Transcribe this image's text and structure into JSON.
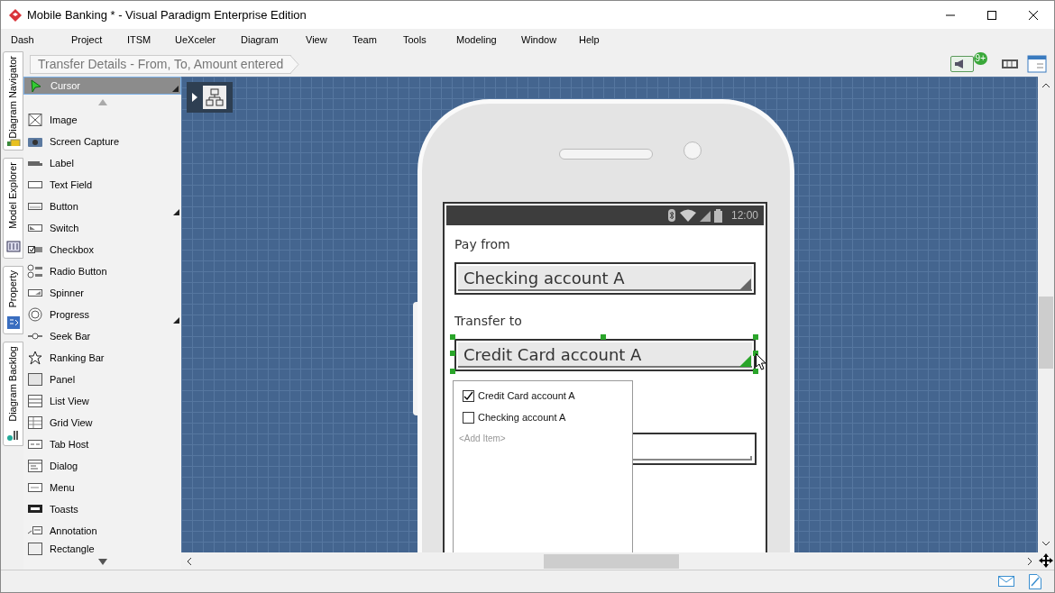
{
  "window": {
    "title": "Mobile Banking * - Visual Paradigm Enterprise Edition"
  },
  "menu": [
    "Dash",
    "Project",
    "ITSM",
    "UeXceler",
    "Diagram",
    "View",
    "Team",
    "Tools",
    "Modeling",
    "Window",
    "Help"
  ],
  "breadcrumb": "Transfer Details - From, To, Amount entered",
  "notifications_badge": "9+",
  "diagram_navigator": {
    "expanded": false
  },
  "side_tabs": [
    "Diagram Navigator",
    "Model Explorer",
    "Property",
    "Diagram Backlog"
  ],
  "palette": [
    {
      "label": "Cursor",
      "selected": true,
      "submenu": true
    },
    {
      "label": "Image",
      "selected": false,
      "submenu": false
    },
    {
      "label": "Screen Capture",
      "selected": false,
      "submenu": false
    },
    {
      "label": "Label",
      "selected": false,
      "submenu": false
    },
    {
      "label": "Text Field",
      "selected": false,
      "submenu": false
    },
    {
      "label": "Button",
      "selected": false,
      "submenu": true
    },
    {
      "label": "Switch",
      "selected": false,
      "submenu": false
    },
    {
      "label": "Checkbox",
      "selected": false,
      "submenu": false
    },
    {
      "label": "Radio Button",
      "selected": false,
      "submenu": false
    },
    {
      "label": "Spinner",
      "selected": false,
      "submenu": false
    },
    {
      "label": "Progress",
      "selected": false,
      "submenu": true
    },
    {
      "label": "Seek Bar",
      "selected": false,
      "submenu": false
    },
    {
      "label": "Ranking Bar",
      "selected": false,
      "submenu": false
    },
    {
      "label": "Panel",
      "selected": false,
      "submenu": false
    },
    {
      "label": "List View",
      "selected": false,
      "submenu": false
    },
    {
      "label": "Grid View",
      "selected": false,
      "submenu": false
    },
    {
      "label": "Tab Host",
      "selected": false,
      "submenu": false
    },
    {
      "label": "Dialog",
      "selected": false,
      "submenu": false
    },
    {
      "label": "Menu",
      "selected": false,
      "submenu": false
    },
    {
      "label": "Toasts",
      "selected": false,
      "submenu": false
    },
    {
      "label": "Annotation",
      "selected": false,
      "submenu": false
    },
    {
      "label": "Rectangle",
      "selected": false,
      "submenu": false
    }
  ],
  "phone": {
    "status_time": "12:00",
    "fields": [
      {
        "label": "Pay from",
        "value": "Checking account A",
        "selected": false
      },
      {
        "label": "Transfer to",
        "value": "Credit Card account A",
        "selected": true
      }
    ],
    "dropdown": {
      "options": [
        {
          "label": "Credit Card account A",
          "checked": true
        },
        {
          "label": "Checking account A",
          "checked": false
        }
      ],
      "add_item": "<Add Item>"
    }
  }
}
